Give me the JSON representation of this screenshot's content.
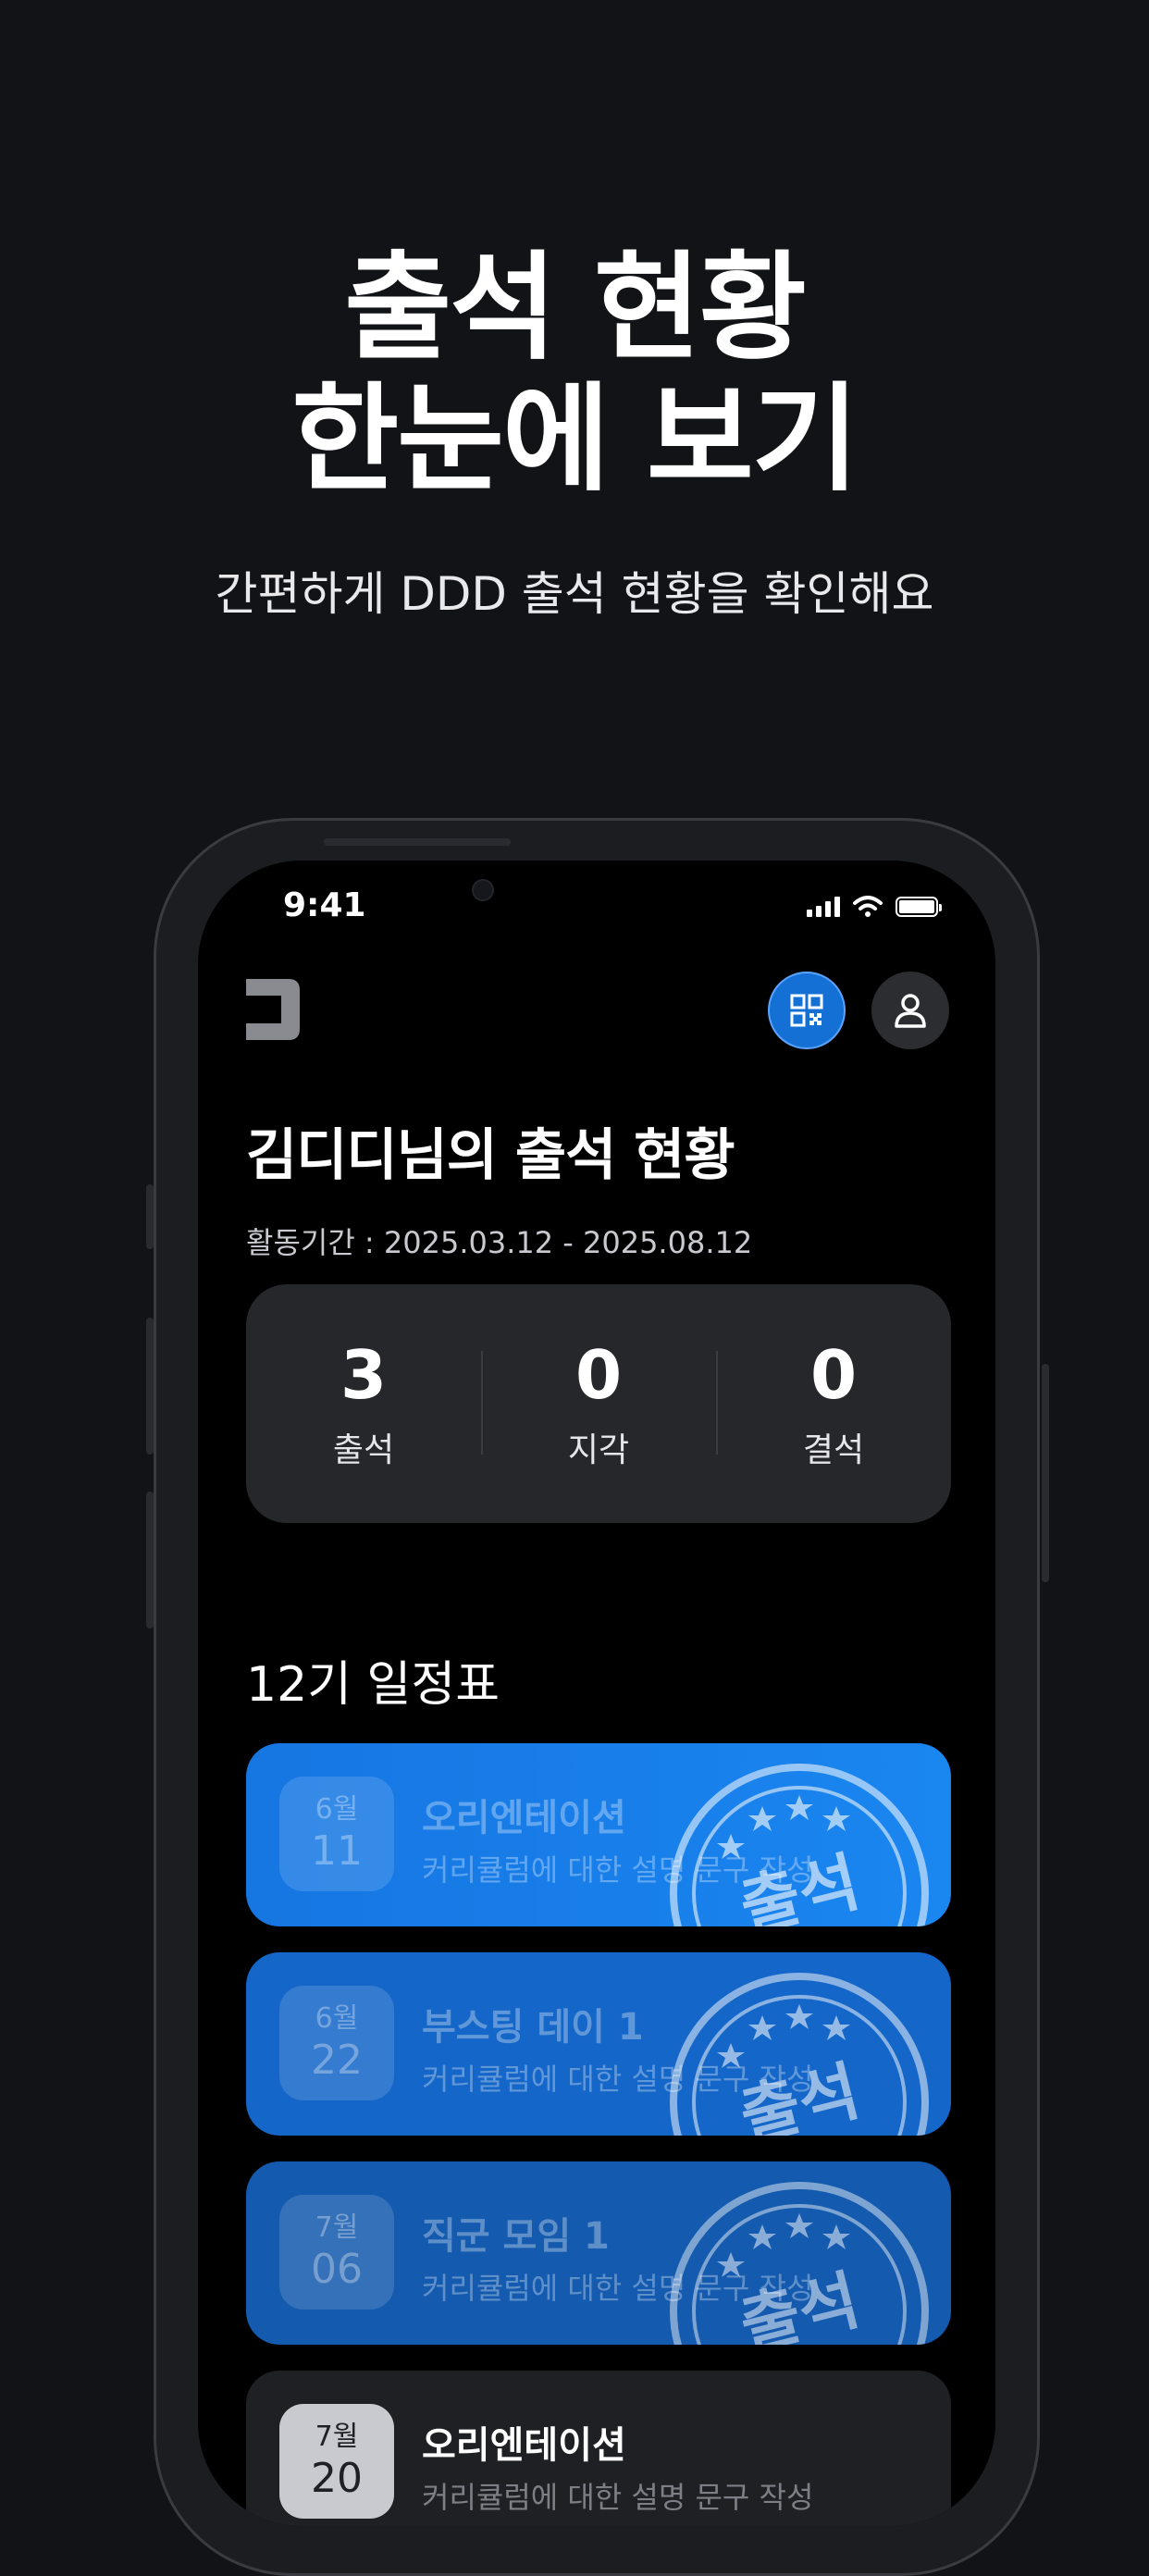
{
  "hero": {
    "title_line1": "출석 현황",
    "title_line2": "한눈에 보기",
    "subtitle": "간편하게 DDD 출석 현황을 확인해요"
  },
  "status_bar": {
    "time": "9:41"
  },
  "header": {
    "qr_icon": "qr-code-icon",
    "profile_icon": "user-icon",
    "accent_color": "#1570d6"
  },
  "page": {
    "title": "김디디님의 출석 현황",
    "period": "활동기간 : 2025.03.12 - 2025.08.12"
  },
  "stats": [
    {
      "value": "3",
      "label": "출석"
    },
    {
      "value": "0",
      "label": "지각"
    },
    {
      "value": "0",
      "label": "결석"
    }
  ],
  "schedule": {
    "title": "12기 일정표",
    "stamp_text": "출석",
    "events": [
      {
        "month": "6월",
        "day": "11",
        "title": "오리엔테이션",
        "desc": "커리큘럼에 대한 설명 문구 작성",
        "status": "attended",
        "color": "#1479e8"
      },
      {
        "month": "6월",
        "day": "22",
        "title": "부스팅 데이 1",
        "desc": "커리큘럼에 대한 설명 문구 작성",
        "status": "attended",
        "color": "#1466c8"
      },
      {
        "month": "7월",
        "day": "06",
        "title": "직군 모임 1",
        "desc": "커리큘럼에 대한 설명 문구 작성",
        "status": "attended",
        "color": "#145aae"
      },
      {
        "month": "7월",
        "day": "20",
        "title": "오리엔테이션",
        "desc": "커리큘럼에 대한 설명 문구 작성",
        "status": "upcoming",
        "color": "#1f2024"
      }
    ]
  }
}
